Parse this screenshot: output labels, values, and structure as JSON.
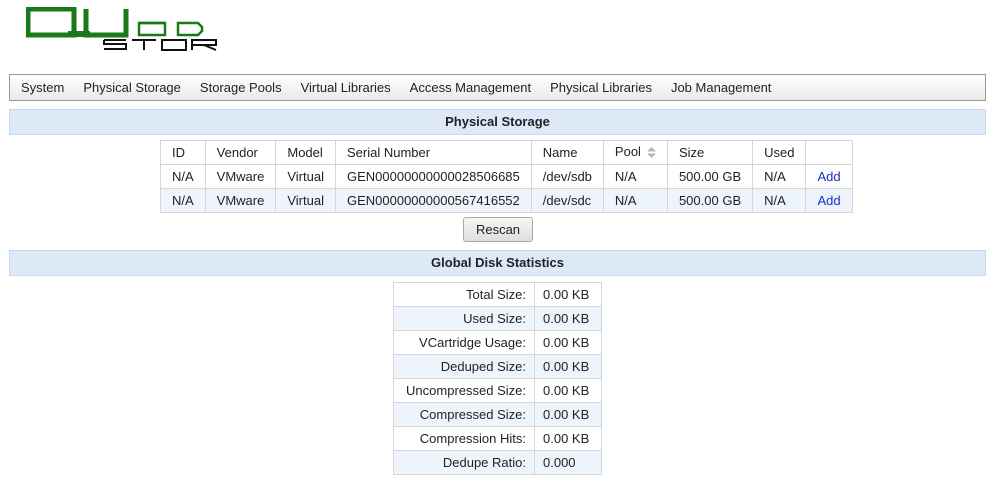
{
  "logo": {
    "text_top": "QUAD",
    "text_bottom": "STOR",
    "color": "#1a7a1a"
  },
  "nav": {
    "items": [
      "System",
      "Physical Storage",
      "Storage Pools",
      "Virtual Libraries",
      "Access Management",
      "Physical Libraries",
      "Job Management"
    ]
  },
  "storage": {
    "title": "Physical Storage",
    "columns": [
      "ID",
      "Vendor",
      "Model",
      "Serial Number",
      "Name",
      "Pool",
      "Size",
      "Used",
      ""
    ],
    "rows": [
      [
        "N/A",
        "VMware",
        "Virtual",
        "GEN00000000000028506685",
        "/dev/sdb",
        "N/A",
        "500.00 GB",
        "N/A",
        "Add"
      ],
      [
        "N/A",
        "VMware",
        "Virtual",
        "GEN00000000000567416552",
        "/dev/sdc",
        "N/A",
        "500.00 GB",
        "N/A",
        "Add"
      ]
    ],
    "rescan_label": "Rescan"
  },
  "stats": {
    "title": "Global Disk Statistics",
    "rows": [
      [
        "Total Size:",
        "0.00 KB"
      ],
      [
        "Used Size:",
        "0.00 KB"
      ],
      [
        "VCartridge Usage:",
        "0.00 KB"
      ],
      [
        "Deduped Size:",
        "0.00 KB"
      ],
      [
        "Uncompressed Size:",
        "0.00 KB"
      ],
      [
        "Compressed Size:",
        "0.00 KB"
      ],
      [
        "Compression Hits:",
        "0.00 KB"
      ],
      [
        "Dedupe Ratio:",
        "0.000"
      ]
    ]
  },
  "colors": {
    "accent_header": "#dde9f7",
    "link": "#1a2fc4",
    "row_alt": "#eef4fb"
  }
}
